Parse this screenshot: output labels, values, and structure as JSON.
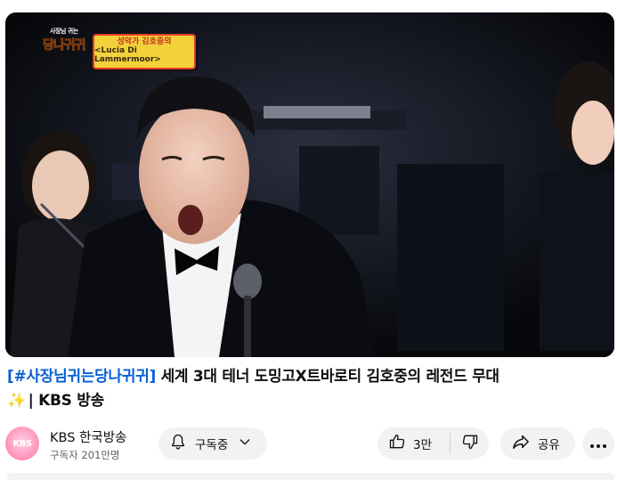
{
  "video": {
    "show_logo_small": "사장님 귀는",
    "show_logo_main": "당나귀귀",
    "caption_line1": "성악가 김호중의",
    "caption_line2": "<Lucia Di Lammermoor>"
  },
  "title": {
    "hashtag": "[#사장님귀는당나귀귀]",
    "text": " 세계 3대 테너 도밍고X트바로티 김호중의 레전드 무대 ",
    "sparkle": "✨",
    "suffix": "| KBS 방송"
  },
  "channel": {
    "avatar_text": "KBS",
    "name": "KBS 한국방송",
    "subscribers": "구독자 201만명"
  },
  "actions": {
    "subscribe_label": "구독중",
    "like_count": "3만",
    "share_label": "공유"
  },
  "icons": {
    "bell": "bell-icon",
    "chevron": "chevron-down-icon",
    "like": "thumbs-up-icon",
    "dislike": "thumbs-down-icon",
    "share": "share-icon",
    "more": "more-icon"
  }
}
